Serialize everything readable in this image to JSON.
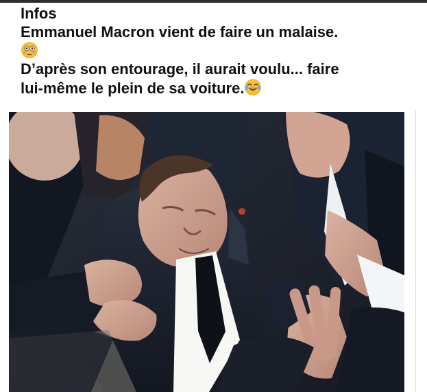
{
  "post": {
    "heading": "Infos",
    "line_1": "Emmanuel Macron vient de faire un malaise.",
    "emoji_1": "flushed-face-icon",
    "line_3": "D’après son entourage, il aurait voulu... faire",
    "line_4": "lui-même le plein de sa voiture.",
    "emoji_2": "face-with-tears-of-joy-icon"
  },
  "photo": {
    "subject": "photo"
  },
  "colors": {
    "text": "#111111",
    "top_bar": "#2b2d31",
    "emoji_face": "#f6c235"
  }
}
